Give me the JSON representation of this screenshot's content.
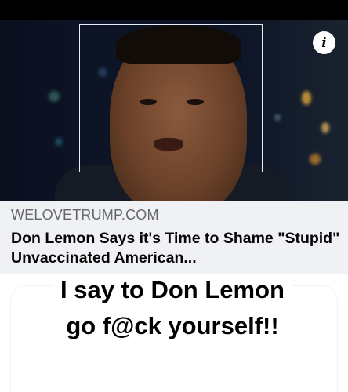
{
  "post": {
    "link_preview": {
      "domain": "WELOVETRUMP.COM",
      "headline": "Don Lemon Says it's Time to Shame \"Stupid\" Unvaccinated American..."
    },
    "info_button_label": "i",
    "overlay_text": "I say to Don Lemon go f@ck yourself!!"
  },
  "colors": {
    "link_card_bg": "#f0f1f4",
    "domain_text": "#65676b",
    "headline_text": "#050505"
  }
}
